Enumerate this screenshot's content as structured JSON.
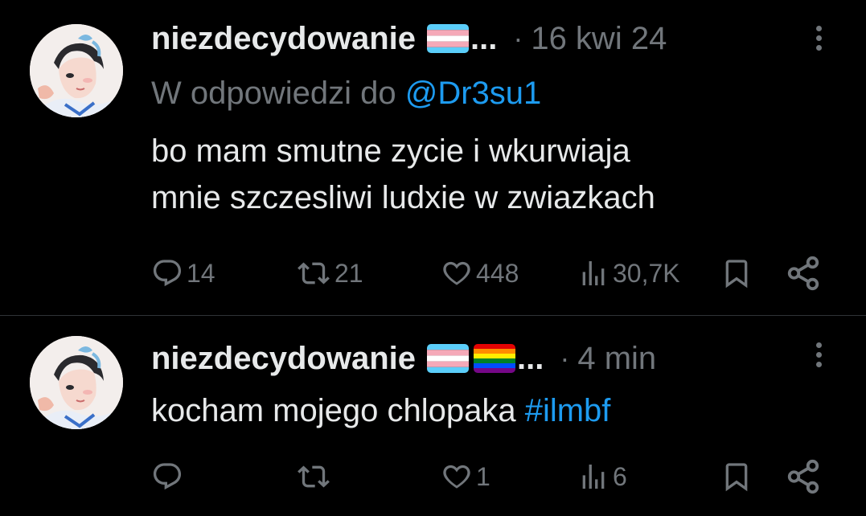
{
  "tweets": [
    {
      "author_name": "niezdecydowanie",
      "name_truncation": "...",
      "separator": "·",
      "timestamp": "16 kwi 24",
      "reply_prefix": "W odpowiedzi do",
      "reply_mention": "@Dr3su1",
      "text_line_1": "bo mam smutne zycie i wkurwiaja",
      "text_line_2": "mnie szczesliwi ludxie w zwiazkach",
      "replies": "14",
      "reposts": "21",
      "likes": "448",
      "views": "30,7K",
      "flags": [
        "transgender-flag"
      ]
    },
    {
      "author_name": "niezdecydowanie",
      "name_truncation": "...",
      "separator": "·",
      "timestamp": "4 min",
      "text_plain": "kocham mojego chlopaka ",
      "text_hashtag": "#ilmbf",
      "replies": "",
      "reposts": "",
      "likes": "1",
      "views": "6",
      "flags": [
        "transgender-flag",
        "rainbow-flag"
      ]
    }
  ],
  "icons": [
    "reply-icon",
    "repost-icon",
    "like-icon",
    "views-icon",
    "bookmark-icon",
    "share-icon",
    "more-icon"
  ],
  "colors": {
    "background": "#000000",
    "primary_text": "#e7e9ea",
    "secondary_text": "#71767b",
    "link": "#1d9bf0",
    "divider": "#2f3336"
  }
}
